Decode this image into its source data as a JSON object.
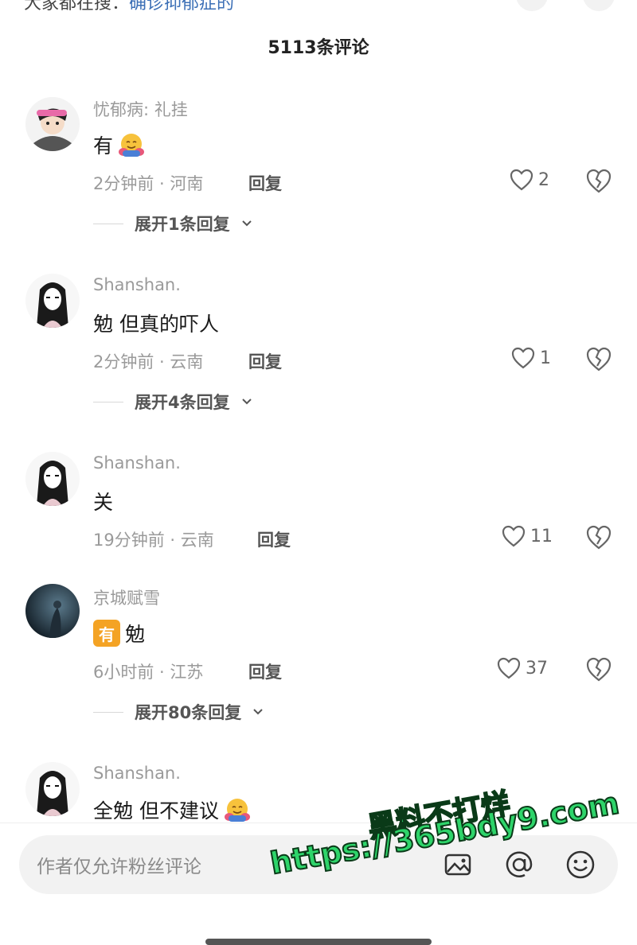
{
  "header": {
    "top_text": "大家都在搜：",
    "top_link": "确诊抑郁症的",
    "comment_count": "5113条评论"
  },
  "comments": [
    {
      "username": "忧郁病: 礼挂",
      "text": "有",
      "emoji": "hug-face-icon",
      "time_location": "2分钟前 · 河南",
      "reply_label": "回复",
      "likes": "2",
      "expand_label": "展开1条回复"
    },
    {
      "username": "Shanshan.",
      "text": "勉 但真的吓人",
      "time_location": "2分钟前 · 云南",
      "reply_label": "回复",
      "likes": "1",
      "expand_label": "展开4条回复"
    },
    {
      "username": "Shanshan.",
      "text": "关",
      "time_location": "19分钟前 · 云南",
      "reply_label": "回复",
      "likes": "11"
    },
    {
      "username": "京城赋雪",
      "badge": "有",
      "text": "勉",
      "time_location": "6小时前 · 江苏",
      "reply_label": "回复",
      "likes": "37",
      "expand_label": "展开80条回复"
    },
    {
      "username": "Shanshan.",
      "text": "全勉 但不建议",
      "emoji": "hug-face-icon"
    }
  ],
  "input": {
    "placeholder": "作者仅允许粉丝评论",
    "icons": [
      "image-icon",
      "at-icon",
      "emoji-smile-icon"
    ]
  },
  "watermark": {
    "line1": "黑料不打烊",
    "line2": "https://365bdy9.com"
  },
  "colors": {
    "accent_link": "#3b6fb6",
    "badge": "#f4a324",
    "watermark": "#2ed46a"
  }
}
